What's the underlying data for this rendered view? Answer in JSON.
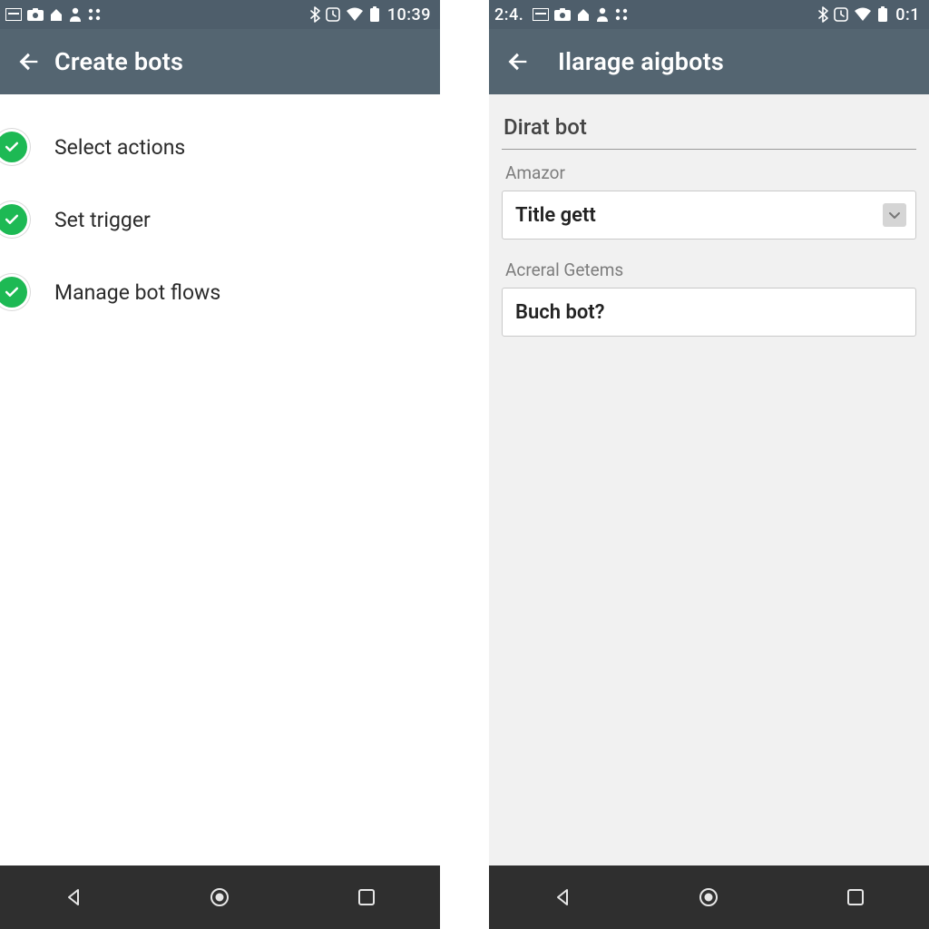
{
  "colors": {
    "statusbar_bg": "#4e5e6b",
    "appbar_bg": "#546571",
    "accent_green": "#1db954",
    "navbar_bg": "#2f2f2f"
  },
  "left_screen": {
    "statusbar": {
      "time": "10:39"
    },
    "appbar": {
      "title": "Create bots"
    },
    "items": [
      {
        "label": "Select actions"
      },
      {
        "label": "Set trigger"
      },
      {
        "label": "Manage bot flows"
      }
    ]
  },
  "right_screen": {
    "statusbar": {
      "left_time": "2:4.",
      "time": "0:1"
    },
    "appbar": {
      "title": "Ilarage aigbots"
    },
    "section_title": "Dirat bot",
    "field1": {
      "label": "Amazor",
      "value": "Title gett"
    },
    "field2": {
      "label": "Acreral Getems",
      "value": "Buch bot?"
    }
  }
}
